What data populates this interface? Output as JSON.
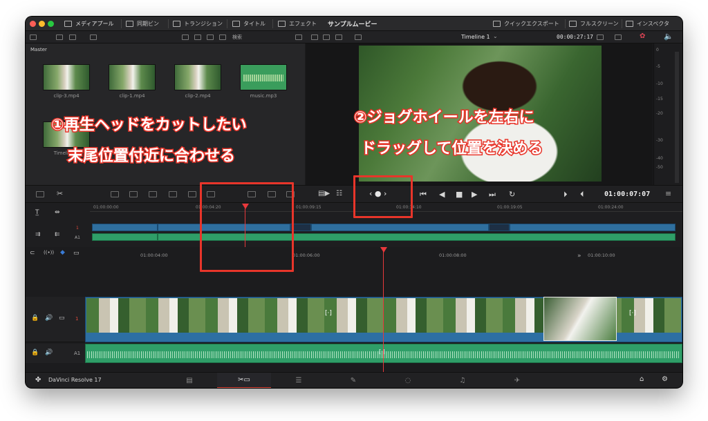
{
  "titlebar": {
    "media_pool": "メディアプール",
    "sync_bin": "同期ビン",
    "transitions": "トランジション",
    "titles": "タイトル",
    "effects": "エフェクト",
    "project_title": "サンプルムービー",
    "quick_export": "クイックエクスポート",
    "fullscreen": "フルスクリーン",
    "inspector": "インスペクタ"
  },
  "media": {
    "search_label": "検索",
    "bin_title": "Master",
    "clips": [
      "clip-3.mp4",
      "clip-1.mp4",
      "clip-2.mp4",
      "music.mp3"
    ],
    "timeline_clip": "Timeline 1"
  },
  "viewer": {
    "timeline_name": "Timeline 1",
    "duration": "00:00:27:17",
    "timecode": "01:00:07:07"
  },
  "meter": {
    "labels": [
      "0",
      "-5",
      "-10",
      "-15",
      "-20",
      "-30",
      "-40",
      "-50"
    ]
  },
  "upper_ruler": [
    "01:00:00:00",
    "01:00:04:20",
    "01:00:09:15",
    "01:00:14:10",
    "01:00:19:05",
    "01:00:24:00"
  ],
  "lower_ruler": [
    "01:00:04:00",
    "01:00:06:00",
    "01:00:08:00",
    "01:00:10:00"
  ],
  "tracks": {
    "video_num": "1",
    "audio_label": "A1",
    "upper_v": "1",
    "upper_a": "A1"
  },
  "bottom": {
    "app_name": "DaVinci Resolve 17"
  },
  "annotations": {
    "one_line1": "①再生ヘッドをカットしたい",
    "one_line2": "末尾位置付近に合わせる",
    "two_line1": "②ジョグホイールを左右に",
    "two_line2": "ドラッグして位置を決める"
  },
  "colors": {
    "accent": "#e8352a",
    "video_clip": "#2f6f9e",
    "audio_clip": "#2f9e68",
    "playhead": "#e8383b"
  }
}
